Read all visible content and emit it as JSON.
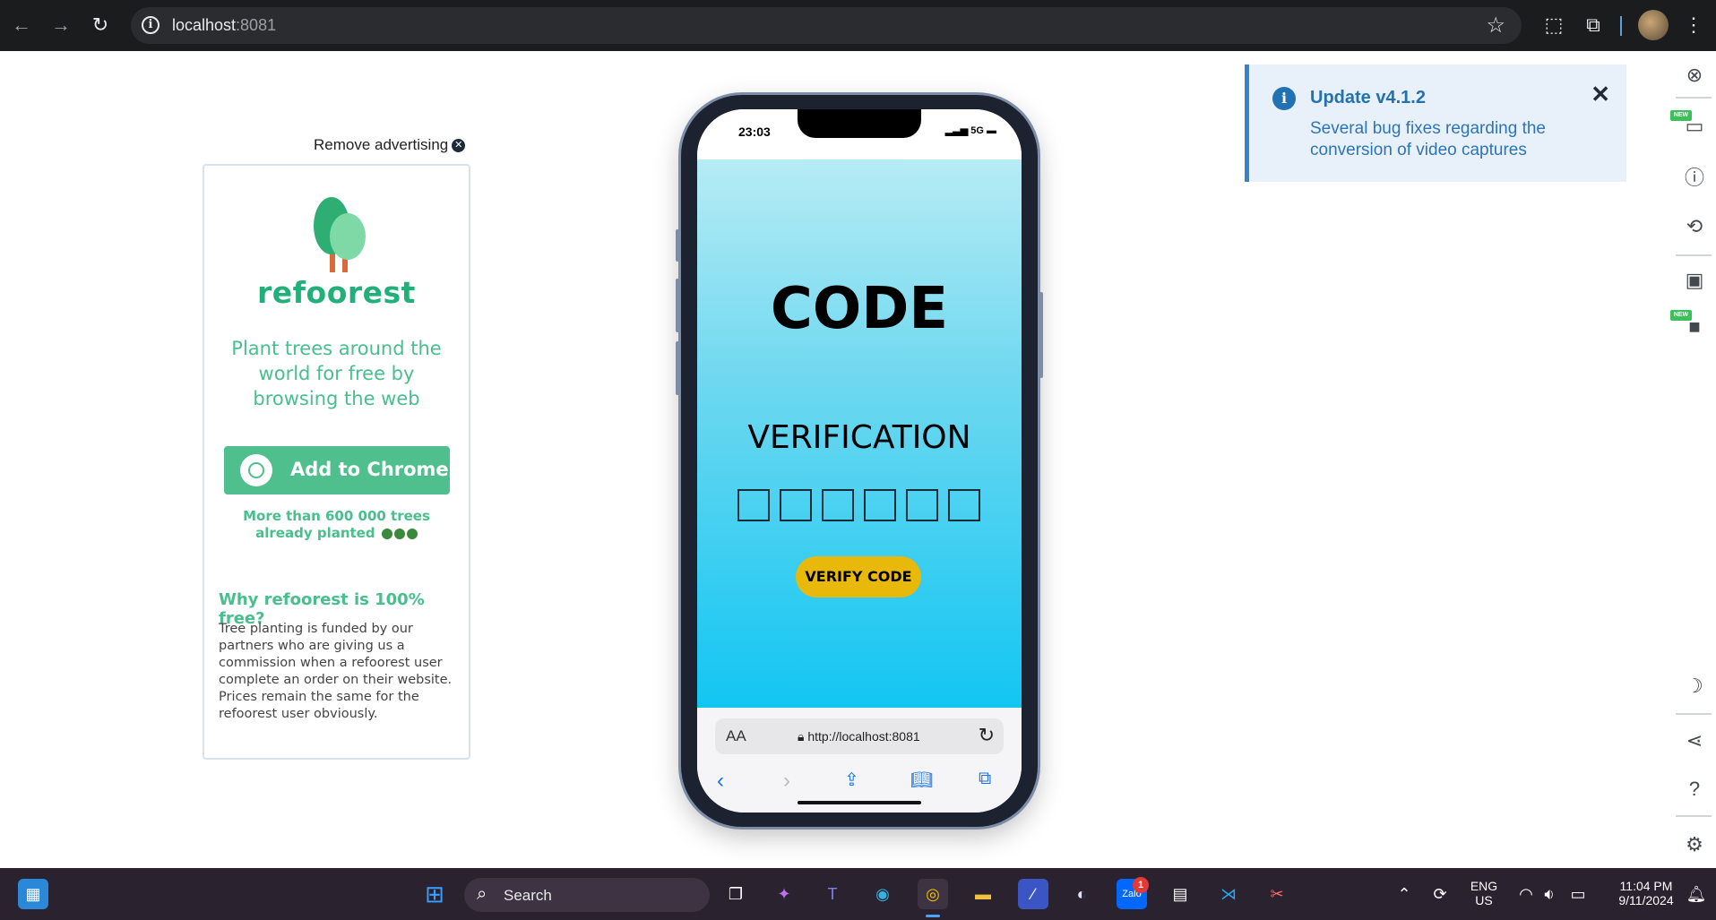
{
  "browser": {
    "url_host": "localhost",
    "url_port": ":8081",
    "nav_back": "←",
    "nav_forward": "→",
    "nav_reload": "↻"
  },
  "ad": {
    "remove_label": "Remove advertising",
    "brand": "refoorest",
    "tagline": "Plant trees around the world for free by browsing the web",
    "add_button": "Add to Chrome",
    "planted": "More than 600 000 trees already planted",
    "why_title": "Why refoorest is 100% free?",
    "why_text": "Tree planting is funded by our partners who are giving us a commission when a refoorest user complete an order on their website. Prices remain the same for the refoorest user obviously."
  },
  "phone": {
    "time": "23:03",
    "network": "5G",
    "title": "CODE",
    "subtitle": "VERIFICATION",
    "otp_boxes": [
      "",
      "",
      "",
      "",
      "",
      ""
    ],
    "verify_button": "VERIFY CODE",
    "safari_aa": "AA",
    "safari_url": "http://localhost:8081"
  },
  "toast": {
    "title": "Update v4.1.2",
    "text": "Several bug fixes regarding the conversion of video captures"
  },
  "right_toolbar": {
    "new_badge": "NEW"
  },
  "taskbar": {
    "search_label": "Search",
    "lang_top": "ENG",
    "lang_bottom": "US",
    "time": "11:04 PM",
    "date": "9/11/2024",
    "zalo_badge": "1",
    "zalo_label": "Zalo"
  },
  "colors": {
    "brand_green": "#21b07a",
    "verify_yellow": "#e8b90a",
    "toast_blue": "#2271b3",
    "app_gradient_top": "#b6ecf4",
    "app_gradient_bottom": "#12c6f2"
  }
}
